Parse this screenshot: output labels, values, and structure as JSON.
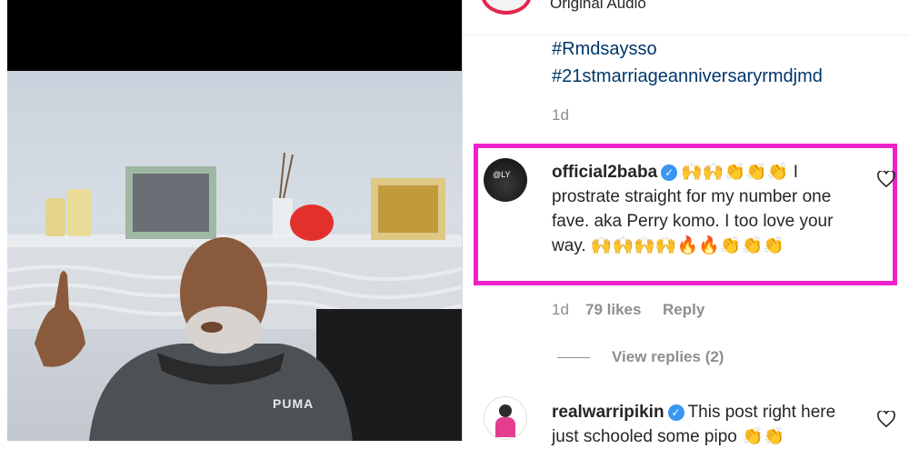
{
  "post": {
    "audio_label": "Original Audio",
    "hashtags": [
      "#Rmdsaysso",
      "#21stmarriageanniversaryrmdjmd"
    ],
    "age": "1d"
  },
  "comments": [
    {
      "username": "official2baba",
      "text": "🙌🙌👏👏👏 I prostrate straight for my number one fave. aka Perry komo. I too love your way. 🙌🙌🙌🙌🔥🔥👏👏👏",
      "age": "1d",
      "likes": "79 likes",
      "reply_label": "Reply",
      "view_replies": "View replies (2)"
    },
    {
      "username": "realwarripikin",
      "text": "This post right here just schooled some pipo 👏👏"
    }
  ],
  "video": {
    "shirt_logo": "PUMA"
  },
  "colors": {
    "highlight": "#ee22cc",
    "link": "#00376b",
    "verified": "#3897f0"
  }
}
